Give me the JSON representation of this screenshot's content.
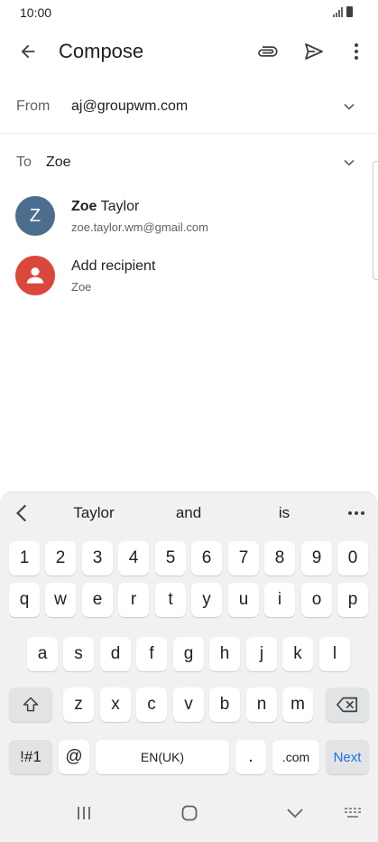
{
  "status": {
    "time": "10:00"
  },
  "app_bar": {
    "title": "Compose",
    "icons": [
      "back-arrow-icon",
      "paperclip-icon",
      "send-icon",
      "more-vert-icon"
    ]
  },
  "from_field": {
    "label": "From",
    "value": "aj@groupwm.com"
  },
  "to_field": {
    "label": "To",
    "value": "Zoe"
  },
  "suggestions": [
    {
      "avatar_letter": "Z",
      "name_bold": "Zoe",
      "name_rest": " Taylor",
      "sub": "zoe.taylor.wm@gmail.com",
      "avatar_color": "#4c6d8e"
    },
    {
      "avatar_letter": "",
      "name_bold": "",
      "name_rest": "Add recipient",
      "sub": "Zoe",
      "avatar_color": "#d9483b"
    }
  ],
  "keyboard": {
    "predictions": [
      "Taylor",
      "and",
      "is"
    ],
    "row_numbers": [
      "1",
      "2",
      "3",
      "4",
      "5",
      "6",
      "7",
      "8",
      "9",
      "0"
    ],
    "row_1": [
      "q",
      "w",
      "e",
      "r",
      "t",
      "y",
      "u",
      "i",
      "o",
      "p"
    ],
    "row_2": [
      "a",
      "s",
      "d",
      "f",
      "g",
      "h",
      "j",
      "k",
      "l"
    ],
    "row_3": [
      "z",
      "x",
      "c",
      "v",
      "b",
      "n",
      "m"
    ],
    "bottom": {
      "symbols": "!#1",
      "at": "@",
      "space": "EN(UK)",
      "period": ".",
      "dotcom": ".com",
      "action": "Next"
    }
  },
  "colors": {
    "accent": "#1a73e8",
    "avatar_blue": "#4c6d8e",
    "avatar_red": "#d9483b",
    "keyboard_bg": "#f1f1f1"
  }
}
